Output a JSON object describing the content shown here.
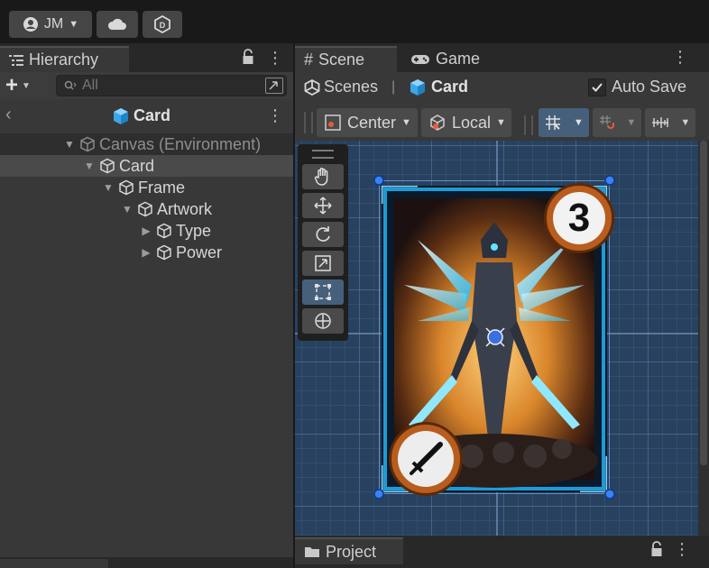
{
  "toolbar": {
    "account_initials": "JM"
  },
  "hierarchy": {
    "tab_label": "Hierarchy",
    "search_placeholder": "All",
    "breadcrumb_title": "Card",
    "items": [
      {
        "label": "Canvas (Environment)",
        "expanded": true,
        "dimmed": true
      },
      {
        "label": "Card",
        "expanded": true,
        "selected": true
      },
      {
        "label": "Frame",
        "expanded": true
      },
      {
        "label": "Artwork",
        "expanded": true
      },
      {
        "label": "Type",
        "expanded": false
      },
      {
        "label": "Power",
        "expanded": false
      }
    ]
  },
  "scene": {
    "tabs": [
      {
        "label": "Scene",
        "active": true
      },
      {
        "label": "Game",
        "active": false
      }
    ],
    "breadcrumb_root": "Scenes",
    "breadcrumb_current": "Card",
    "auto_save_label": "Auto Save",
    "auto_save_checked": true,
    "pivot_label": "Center",
    "space_label": "Local"
  },
  "card": {
    "cost": "3",
    "power_icon": "sword-icon"
  },
  "project": {
    "tab_label": "Project"
  },
  "colors": {
    "scene_bg": "#27415f",
    "grid_line": "#4d6b8d",
    "card_border": "#1e9bd6",
    "selection": "#3b82f6",
    "panel": "#383838",
    "tab_strip": "#282828"
  }
}
